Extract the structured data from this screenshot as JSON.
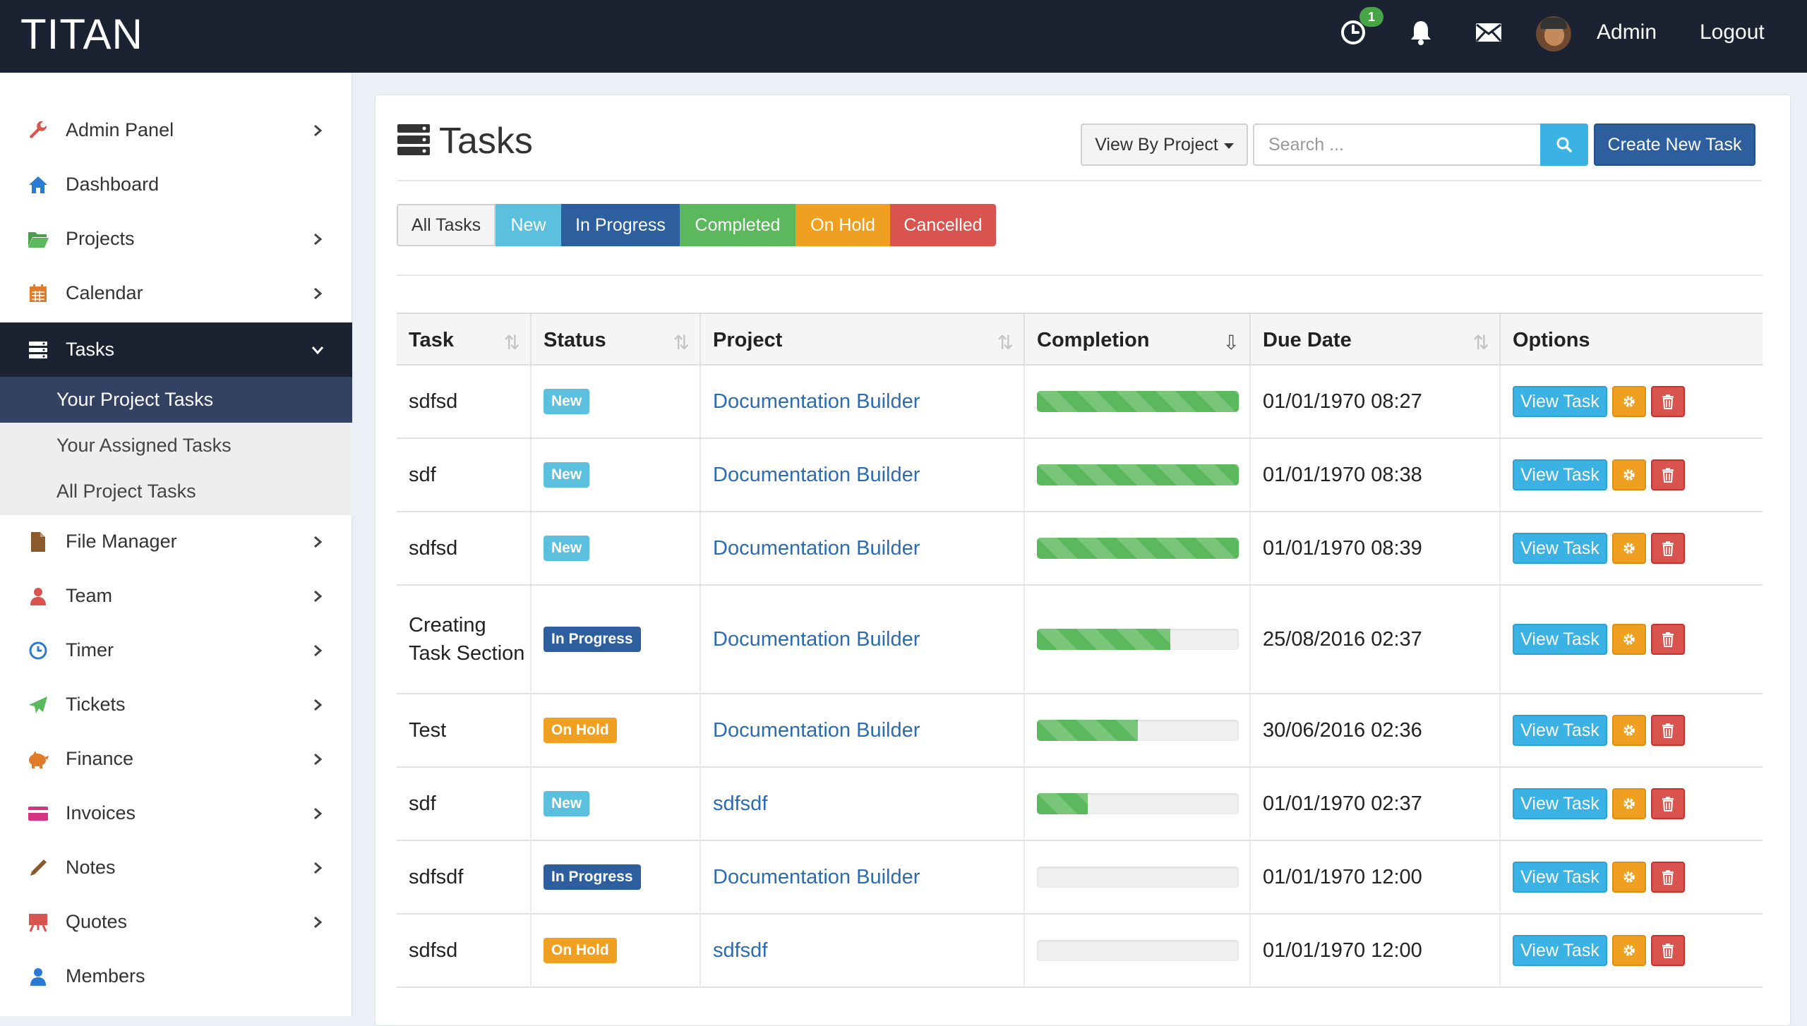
{
  "app": {
    "brand": "TITAN"
  },
  "topbar": {
    "timer_badge": "1",
    "user_name": "Admin",
    "logout_label": "Logout"
  },
  "sidebar": {
    "items": [
      {
        "label": "Admin Panel",
        "icon": "wrench-icon",
        "color": "#d9534f",
        "has_children": true
      },
      {
        "label": "Dashboard",
        "icon": "home-icon",
        "color": "#2a7ad4",
        "has_children": false
      },
      {
        "label": "Projects",
        "icon": "folder-icon",
        "color": "#5cb85c",
        "has_children": true
      },
      {
        "label": "Calendar",
        "icon": "calendar-icon",
        "color": "#e07b2a",
        "has_children": true
      },
      {
        "label": "Tasks",
        "icon": "tasks-icon",
        "color": "#ffffff",
        "has_children": true,
        "active": true
      },
      {
        "label": "File Manager",
        "icon": "file-icon",
        "color": "#8b5a2b",
        "has_children": true
      },
      {
        "label": "Team",
        "icon": "user-icon",
        "color": "#d9534f",
        "has_children": true
      },
      {
        "label": "Timer",
        "icon": "clock-icon",
        "color": "#2a7ad4",
        "has_children": true
      },
      {
        "label": "Tickets",
        "icon": "send-icon",
        "color": "#5cb85c",
        "has_children": true
      },
      {
        "label": "Finance",
        "icon": "piggy-bank-icon",
        "color": "#e07b2a",
        "has_children": true
      },
      {
        "label": "Invoices",
        "icon": "credit-card-icon",
        "color": "#d63384",
        "has_children": true
      },
      {
        "label": "Notes",
        "icon": "pencil-icon",
        "color": "#8b5a2b",
        "has_children": true
      },
      {
        "label": "Quotes",
        "icon": "easel-icon",
        "color": "#d9534f",
        "has_children": true
      },
      {
        "label": "Members",
        "icon": "user-icon",
        "color": "#2a7ad4",
        "has_children": false
      }
    ],
    "tasks_submenu": [
      {
        "label": "Your Project Tasks",
        "active": true
      },
      {
        "label": "Your Assigned Tasks",
        "active": false
      },
      {
        "label": "All Project Tasks",
        "active": false
      }
    ]
  },
  "page": {
    "title": "Tasks",
    "view_by_label": "View By Project",
    "search_placeholder": "Search ...",
    "create_label": "Create New Task"
  },
  "filters": [
    {
      "label": "All Tasks",
      "color": "#f4f4f4"
    },
    {
      "label": "New",
      "color": "#5bc0de"
    },
    {
      "label": "In Progress",
      "color": "#2d5f9e"
    },
    {
      "label": "Completed",
      "color": "#5cb85c"
    },
    {
      "label": "On Hold",
      "color": "#f0a020"
    },
    {
      "label": "Cancelled",
      "color": "#d9534f"
    }
  ],
  "table": {
    "columns": [
      "Task",
      "Status",
      "Project",
      "Completion",
      "Due Date",
      "Options"
    ],
    "view_label": "View Task",
    "rows": [
      {
        "task": "sdfsd",
        "status": "New",
        "status_color": "#5bc0de",
        "project": "Documentation Builder",
        "completion": 100,
        "due": "01/01/1970 08:27"
      },
      {
        "task": "sdf",
        "status": "New",
        "status_color": "#5bc0de",
        "project": "Documentation Builder",
        "completion": 100,
        "due": "01/01/1970 08:38"
      },
      {
        "task": "sdfsd",
        "status": "New",
        "status_color": "#5bc0de",
        "project": "Documentation Builder",
        "completion": 100,
        "due": "01/01/1970 08:39"
      },
      {
        "task": "Creating Task Section",
        "status": "In Progress",
        "status_color": "#2d5f9e",
        "project": "Documentation Builder",
        "completion": 66,
        "due": "25/08/2016 02:37"
      },
      {
        "task": "Test",
        "status": "On Hold",
        "status_color": "#f0a020",
        "project": "Documentation Builder",
        "completion": 50,
        "due": "30/06/2016 02:36"
      },
      {
        "task": "sdf",
        "status": "New",
        "status_color": "#5bc0de",
        "project": "sdfsdf",
        "completion": 25,
        "due": "01/01/1970 02:37"
      },
      {
        "task": "sdfsdf",
        "status": "In Progress",
        "status_color": "#2d5f9e",
        "project": "Documentation Builder",
        "completion": 0,
        "due": "01/01/1970 12:00"
      },
      {
        "task": "sdfsd",
        "status": "On Hold",
        "status_color": "#f0a020",
        "project": "sdfsdf",
        "completion": 0,
        "due": "01/01/1970 12:00"
      }
    ]
  }
}
